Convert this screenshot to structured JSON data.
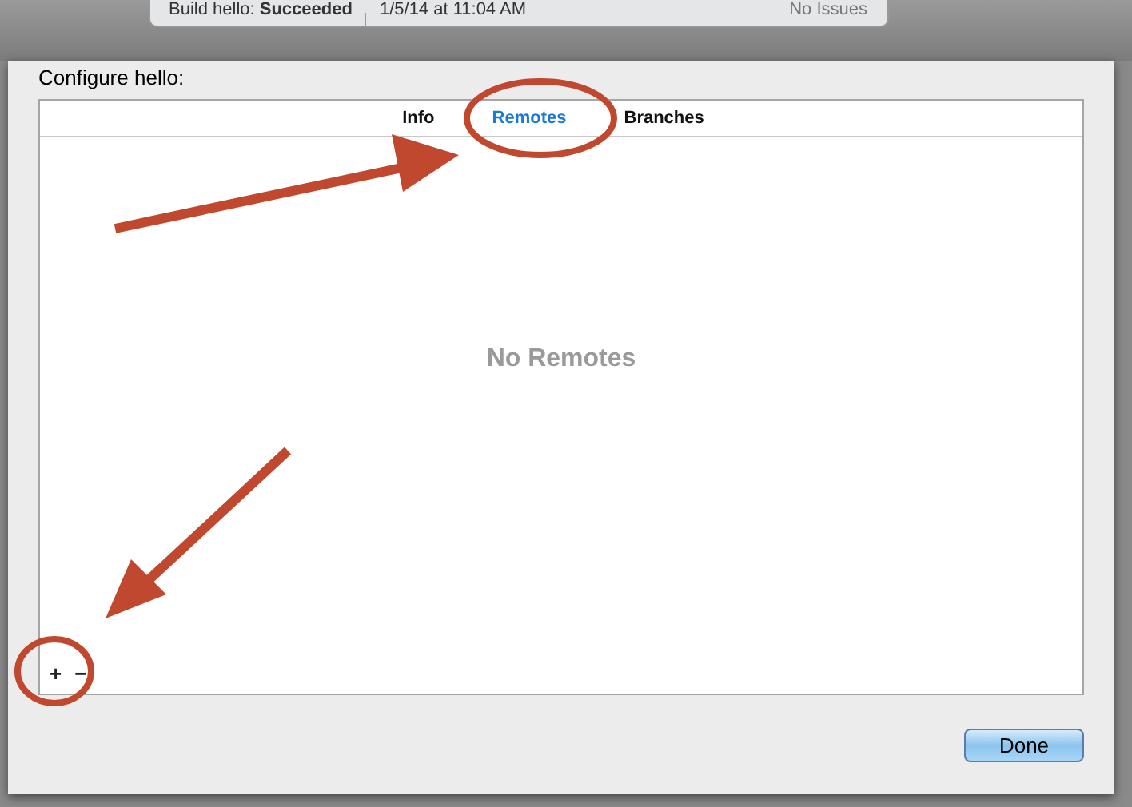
{
  "activity_viewer": {
    "status": "Build hello: **Succeeded**",
    "timestamp": "1/5/14 at 11:04 AM",
    "issues": "No Issues"
  },
  "sheet": {
    "title": "Configure hello:",
    "tabs": [
      {
        "label": "Info",
        "selected": false
      },
      {
        "label": "Remotes",
        "selected": true
      },
      {
        "label": "Branches",
        "selected": false
      }
    ],
    "empty_message": "No Remotes",
    "add_symbol": "+",
    "remove_symbol": "−",
    "buttons": [
      "Done"
    ]
  }
}
